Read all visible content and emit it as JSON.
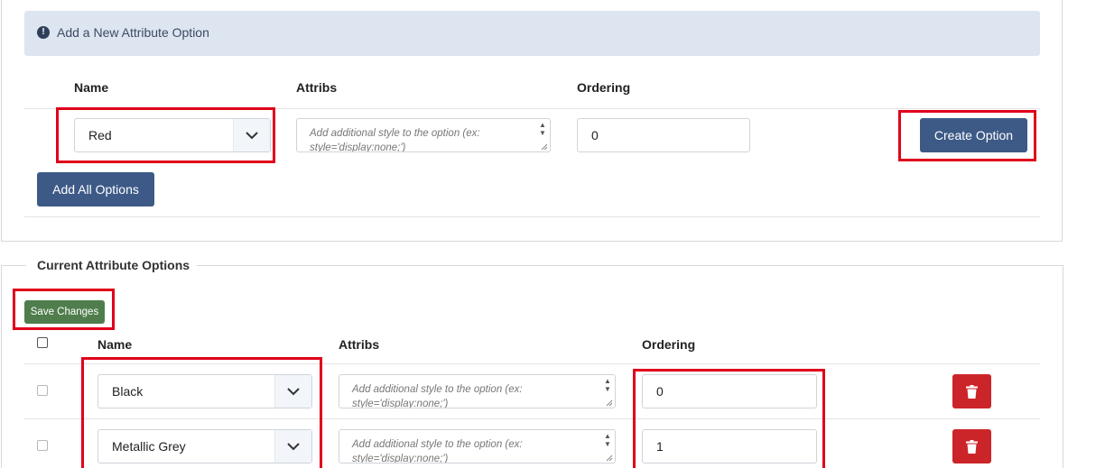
{
  "new_option": {
    "info_text": "Add a New Attribute Option",
    "headers": {
      "name": "Name",
      "attribs": "Attribs",
      "ordering": "Ordering"
    },
    "name_value": "Red",
    "attribs_placeholder": "Add additional style to the option (ex: style='display:none;')",
    "ordering_value": "0",
    "create_button": "Create Option",
    "add_all_button": "Add All Options"
  },
  "current": {
    "legend": "Current Attribute Options",
    "save_button": "Save Changes",
    "headers": {
      "name": "Name",
      "attribs": "Attribs",
      "ordering": "Ordering"
    },
    "rows": [
      {
        "name": "Black",
        "attribs_placeholder": "Add additional style to the option (ex: style='display:none;')",
        "ordering": "0"
      },
      {
        "name": "Metallic Grey",
        "attribs_placeholder": "Add additional style to the option (ex: style='display:none;')",
        "ordering": "1"
      }
    ]
  },
  "icons": {
    "info": "info-circle-icon",
    "chevron": "chevron-down-icon",
    "trash": "trash-icon"
  },
  "colors": {
    "primary": "#3d5a87",
    "success": "#4f7e4c",
    "danger": "#cc2529",
    "highlight": "#e0001b",
    "info_bg": "#dde5f0"
  }
}
